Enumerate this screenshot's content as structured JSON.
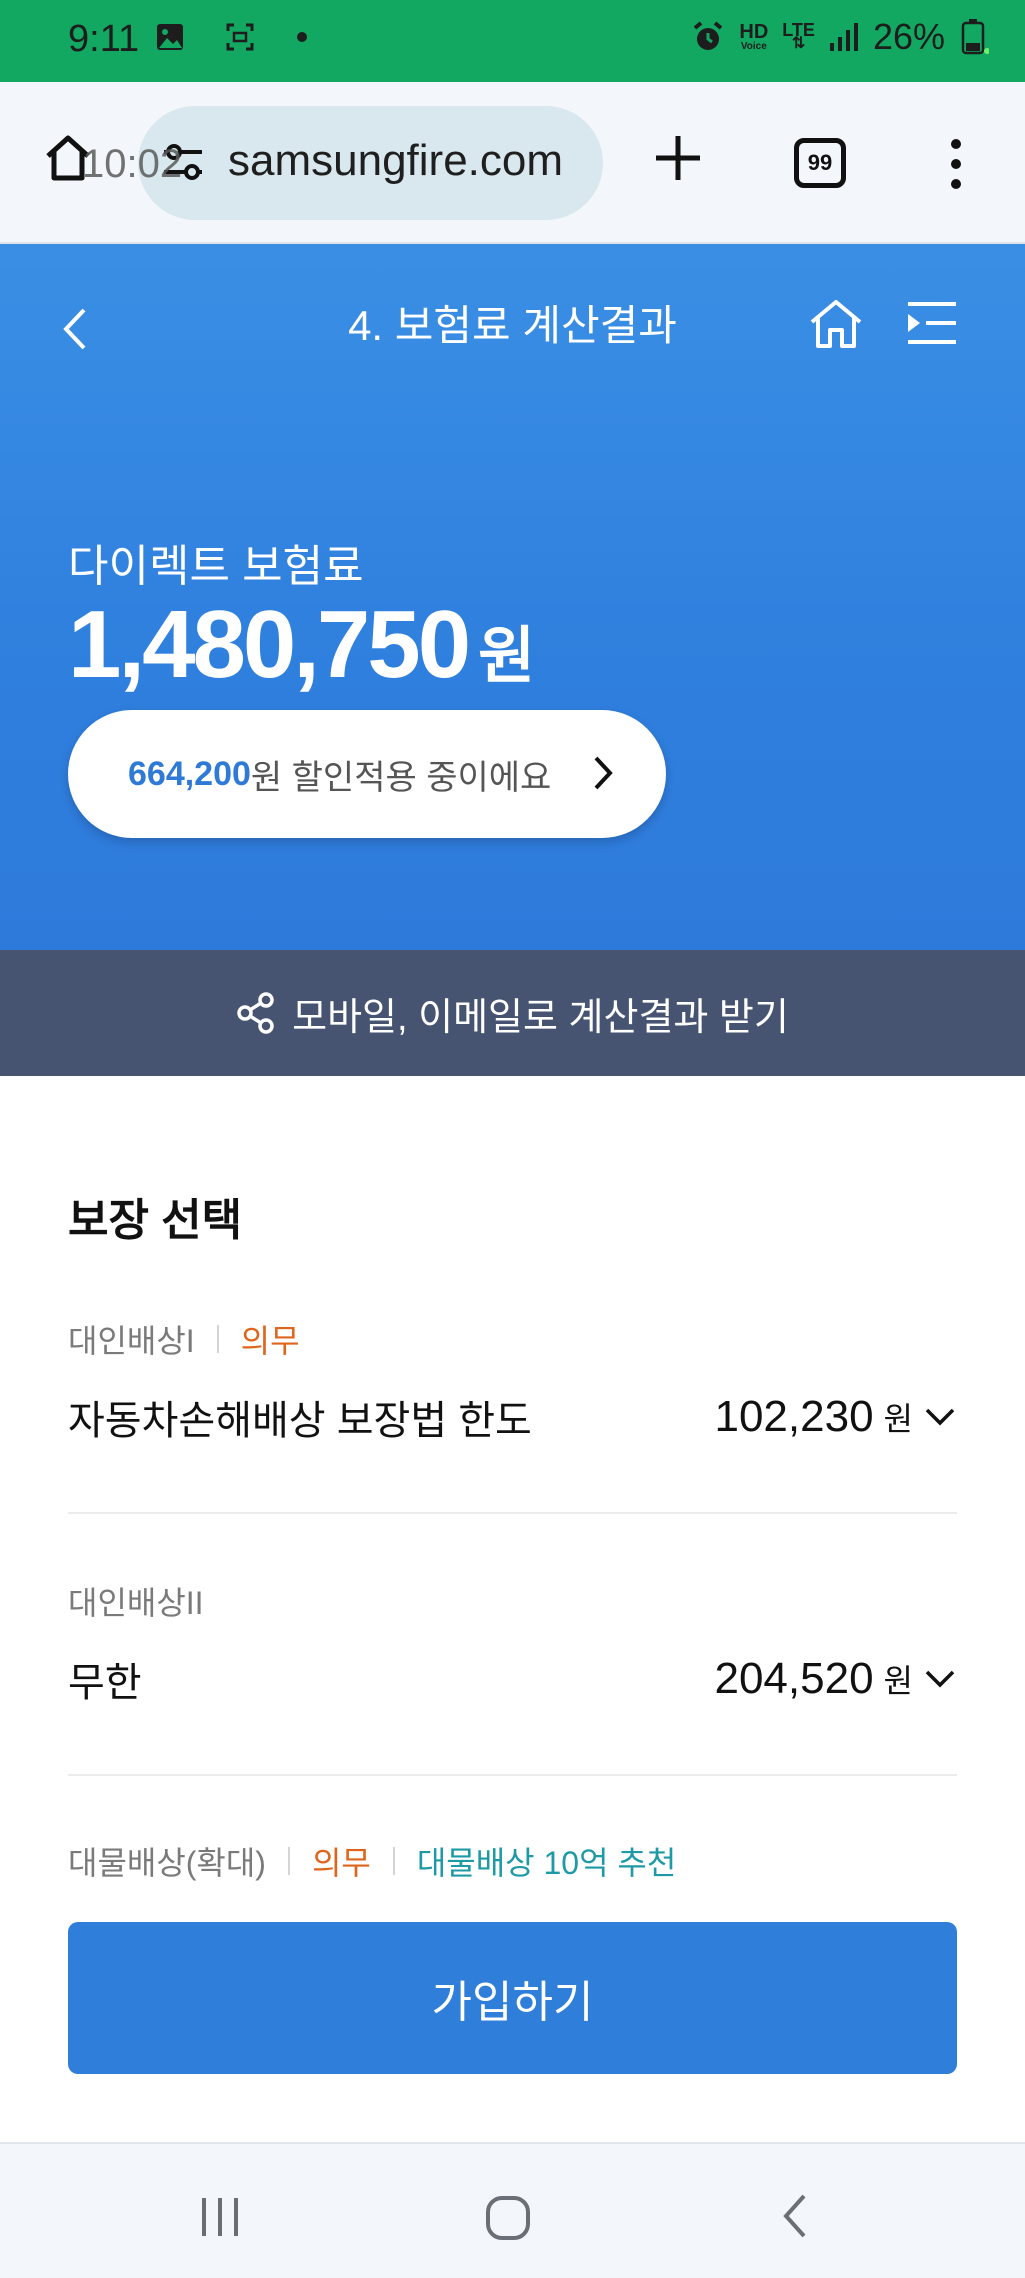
{
  "status_bar": {
    "time": "9:11",
    "hd_label": "HD",
    "voice_label": "Voice",
    "lte_label": "LTE",
    "battery": "26%"
  },
  "browser": {
    "ghost_time": "10:02",
    "url": "samsungfire.com",
    "tab_count": "99"
  },
  "header": {
    "title": "4. 보험료 계산결과"
  },
  "premium": {
    "label": "다이렉트 보험료",
    "amount": "1,480,750",
    "unit": "원"
  },
  "discount": {
    "amount": "664,200",
    "text": "원 할인적용 중이에요"
  },
  "share": {
    "label": "모바일, 이메일로 계산결과 받기"
  },
  "coverage": {
    "title": "보장 선택",
    "items": [
      {
        "tag": "대인배상I",
        "mandatory": "의무",
        "name": "자동차손해배상 보장법 한도",
        "price": "102,230",
        "unit": "원"
      },
      {
        "tag": "대인배상II",
        "name": "무한",
        "price": "204,520",
        "unit": "원"
      },
      {
        "tag": "대물배상(확대)",
        "mandatory": "의무",
        "recommend": "대물배상 10억 추천"
      }
    ]
  },
  "cta": {
    "label": "가입하기"
  },
  "colors": {
    "status": "#13a862",
    "primary": "#2f7ed9",
    "share_bar": "#465471",
    "mandatory": "#e0651c",
    "recommend": "#1e9aa6"
  }
}
